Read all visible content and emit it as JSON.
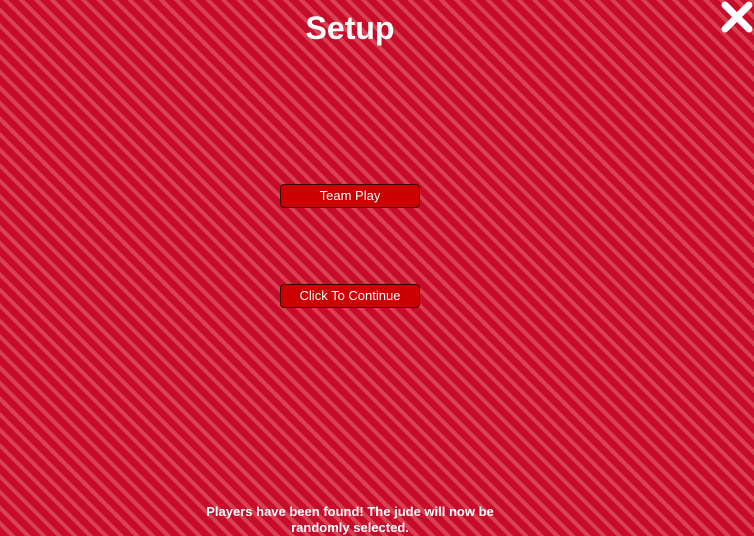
{
  "header": {
    "title": "Setup"
  },
  "controls": {
    "close_icon": "close-icon",
    "team_play_label": "Team Play",
    "continue_label": "Click To Continue"
  },
  "status": {
    "message": "Players have been found! The jude will now be randomly selected."
  },
  "colors": {
    "background": "#c80a2c",
    "stripe": "#d8414f",
    "button": "#cc0000",
    "text": "#ffffff"
  }
}
